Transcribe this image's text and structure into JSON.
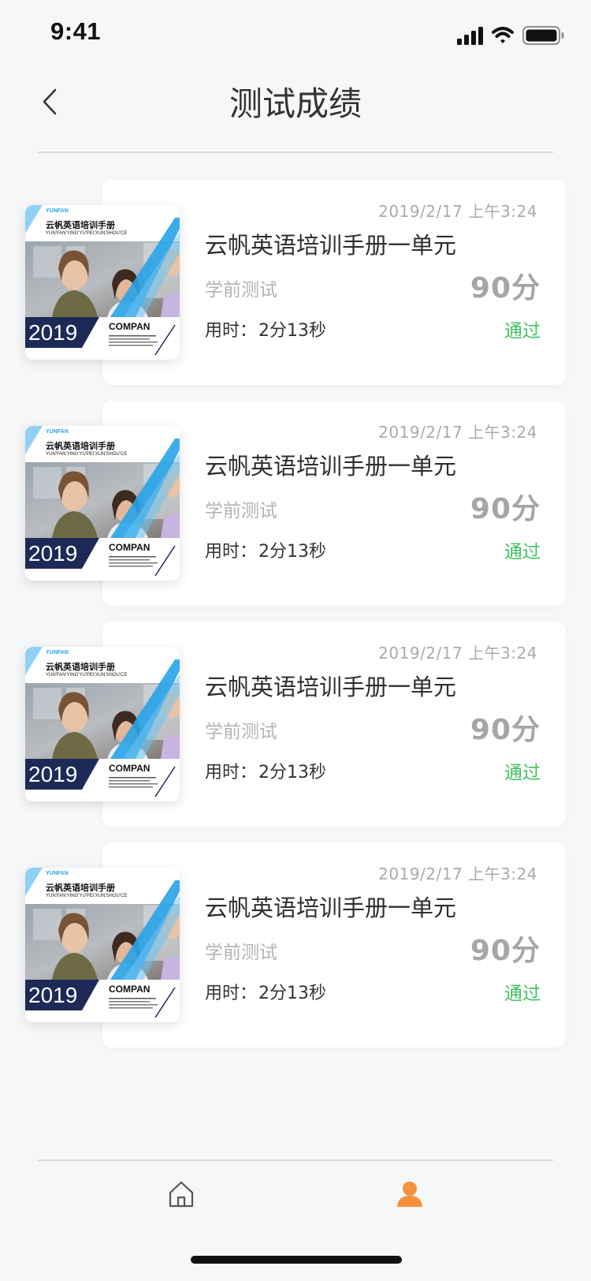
{
  "status_bar": {
    "time": "9:41",
    "icons": [
      "cellular-signal",
      "wifi",
      "battery"
    ]
  },
  "header": {
    "title": "测试成绩",
    "back_icon": "chevron-left-icon"
  },
  "cover": {
    "brand": "YUNFAN",
    "title": "云帆英语培训手册",
    "subtitle": "YUN'FAN'YING'YU'PEI'XUN'SHOU'CE",
    "year": "2019",
    "company": "COMPAN"
  },
  "records": [
    {
      "date": "2019/2/17 上午3:24",
      "title": "云帆英语培训手册一单元",
      "type": "学前测试",
      "score": "90分",
      "time_label": "用时：",
      "time_value": "2分13秒",
      "status": "通过"
    },
    {
      "date": "2019/2/17 上午3:24",
      "title": "云帆英语培训手册一单元",
      "type": "学前测试",
      "score": "90分",
      "time_label": "用时：",
      "time_value": "2分13秒",
      "status": "通过"
    },
    {
      "date": "2019/2/17 上午3:24",
      "title": "云帆英语培训手册一单元",
      "type": "学前测试",
      "score": "90分",
      "time_label": "用时：",
      "time_value": "2分13秒",
      "status": "通过"
    },
    {
      "date": "2019/2/17 上午3:24",
      "title": "云帆英语培训手册一单元",
      "type": "学前测试",
      "score": "90分",
      "time_label": "用时：",
      "time_value": "2分13秒",
      "status": "通过"
    }
  ],
  "bottom_nav": {
    "items": [
      {
        "icon": "home-icon",
        "active": false
      },
      {
        "icon": "user-icon",
        "active": true
      }
    ]
  },
  "colors": {
    "background": "#f6f7f9",
    "pass": "#3ec25d",
    "score": "#a6a6a6",
    "active_tab": "#f5913a",
    "inactive_tab": "#555555",
    "cover_navy": "#1d2a57",
    "cover_blue": "#29a3e8"
  }
}
